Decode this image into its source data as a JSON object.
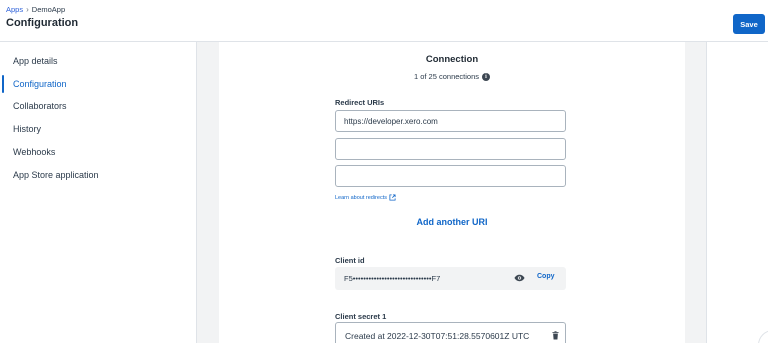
{
  "header": {
    "breadcrumb": {
      "root": "Apps",
      "separator": "›",
      "current": "DemoApp"
    },
    "title": "Configuration",
    "save_label": "Save"
  },
  "sidebar": {
    "items": [
      {
        "label": "App details",
        "active": false
      },
      {
        "label": "Configuration",
        "active": true
      },
      {
        "label": "Collaborators",
        "active": false
      },
      {
        "label": "History",
        "active": false
      },
      {
        "label": "Webhooks",
        "active": false
      },
      {
        "label": "App Store application",
        "active": false
      }
    ]
  },
  "connection": {
    "title": "Connection",
    "count_text": "1 of 25 connections",
    "info_icon": "info-icon",
    "redirect_label": "Redirect URIs",
    "redirect_uris": [
      "https://developer.xero.com",
      "",
      ""
    ],
    "learn_link": "Learn about redirects",
    "add_uri": "Add another URI",
    "client_id_label": "Client id",
    "client_id_masked": "F5••••••••••••••••••••••••••••••F7",
    "copy_label": "Copy",
    "client_secret_label": "Client secret 1",
    "client_secret_text": "Created at 2022-12-30T07:51:28.5570601Z UTC"
  },
  "colors": {
    "accent": "#1066c8",
    "canvas": "#f2f3f4",
    "border": "#dfe3e8"
  }
}
